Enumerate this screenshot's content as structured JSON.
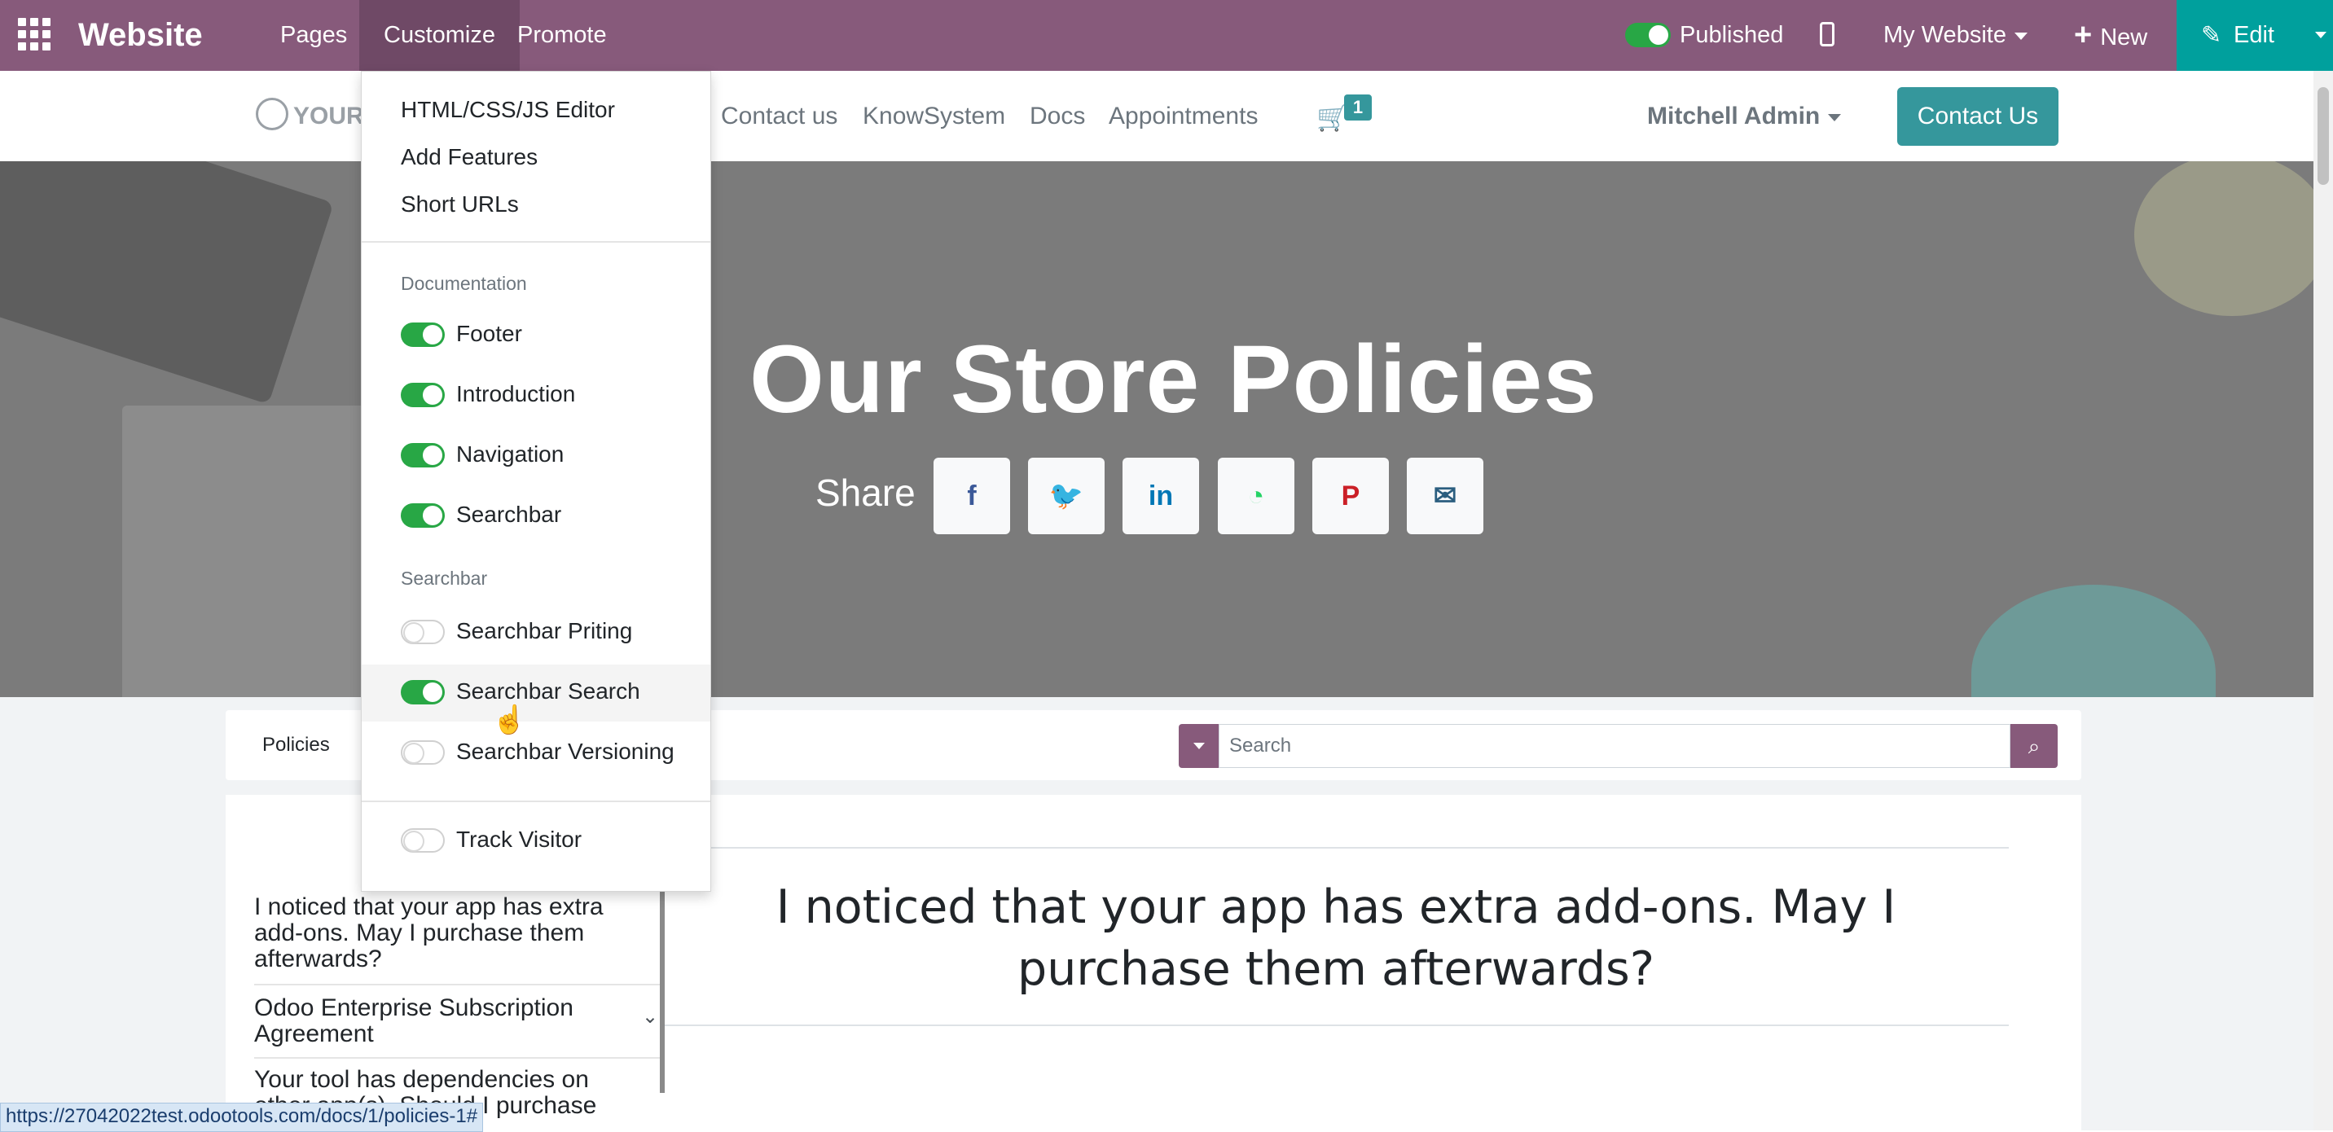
{
  "topbar": {
    "app_name": "Website",
    "menu": [
      "Pages",
      "Customize",
      "Promote"
    ],
    "published_label": "Published",
    "website_selector": "My Website",
    "new_label": "New",
    "edit_label": "Edit",
    "bg_color": "#875A7B",
    "edit_color": "#00A09D"
  },
  "site_header": {
    "logo_text": "YOUR",
    "menu": [
      "Contact us",
      "KnowSystem",
      "Docs",
      "Appointments"
    ],
    "cart_count": "1",
    "user_name": "Mitchell Admin",
    "cta_label": "Contact Us"
  },
  "hero": {
    "title": "Our Store Policies",
    "share_label": "Share",
    "share_buttons": [
      {
        "icon": "facebook-icon",
        "glyph": "f",
        "color": "#3b5998"
      },
      {
        "icon": "twitter-icon",
        "glyph": "🐦",
        "color": "#1da1f2"
      },
      {
        "icon": "linkedin-icon",
        "glyph": "in",
        "color": "#0077b5"
      },
      {
        "icon": "whatsapp-icon",
        "glyph": "◔",
        "color": "#25d366"
      },
      {
        "icon": "pinterest-icon",
        "glyph": "P",
        "color": "#cb2027"
      },
      {
        "icon": "envelope-icon",
        "glyph": "✉",
        "color": "#2b5e7f"
      }
    ]
  },
  "docs": {
    "breadcrumb": "Policies",
    "search_placeholder": "Search",
    "toc": [
      "I noticed that your app has extra add-ons. May I purchase them afterwards?",
      "Odoo Enterprise Subscription Agreement",
      "Your tool has dependencies on other app(s). Should I purchase"
    ],
    "article_title": "I noticed that your app has extra add-ons. May I purchase them afterwards?"
  },
  "customize_menu": {
    "items": [
      "HTML/CSS/JS Editor",
      "Add Features",
      "Short URLs"
    ],
    "section_documentation": "Documentation",
    "doc_toggles": [
      {
        "label": "Footer",
        "on": true
      },
      {
        "label": "Introduction",
        "on": true
      },
      {
        "label": "Navigation",
        "on": true
      },
      {
        "label": "Searchbar",
        "on": true
      }
    ],
    "section_searchbar": "Searchbar",
    "search_toggles": [
      {
        "label": "Searchbar Priting",
        "on": false
      },
      {
        "label": "Searchbar Search",
        "on": true
      },
      {
        "label": "Searchbar Versioning",
        "on": false
      }
    ],
    "track_visitor": {
      "label": "Track Visitor",
      "on": false
    }
  },
  "status_url": "https://27042022test.odootools.com/docs/1/policies-1#"
}
